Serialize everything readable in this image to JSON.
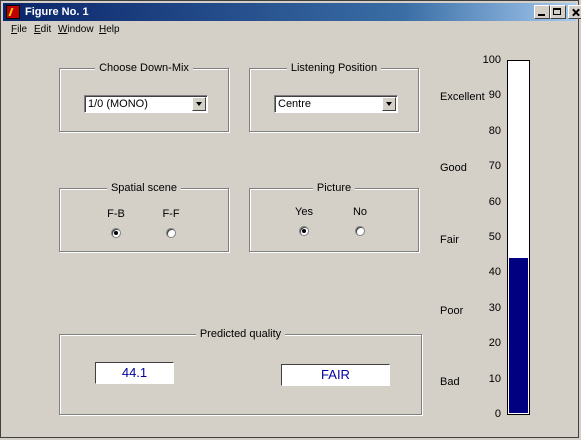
{
  "window": {
    "title": "Figure No. 1"
  },
  "menu": [
    {
      "label": "File",
      "u": "F",
      "rest": "ile"
    },
    {
      "label": "Edit",
      "u": "E",
      "rest": "dit"
    },
    {
      "label": "Window",
      "u": "W",
      "rest": "indow"
    },
    {
      "label": "Help",
      "u": "H",
      "rest": "elp"
    }
  ],
  "downmix": {
    "title": "Choose Down-Mix",
    "selected": "1/0 (MONO)"
  },
  "listening": {
    "title": "Listening Position",
    "selected": "Centre"
  },
  "spatial": {
    "title": "Spatial scene",
    "options": [
      {
        "label": "F-B",
        "selected": true
      },
      {
        "label": "F-F",
        "selected": false
      }
    ]
  },
  "picture": {
    "title": "Picture",
    "options": [
      {
        "label": "Yes",
        "selected": true
      },
      {
        "label": "No",
        "selected": false
      }
    ]
  },
  "predicted": {
    "title": "Predicted quality",
    "score": "44.1",
    "grade": "FAIR"
  },
  "scale": {
    "grades": [
      "Excellent",
      "Good",
      "Fair",
      "Poor",
      "Bad"
    ],
    "ticks": [
      "100",
      "90",
      "80",
      "70",
      "60",
      "50",
      "40",
      "30",
      "20",
      "10",
      "0"
    ],
    "value": 44.1,
    "min": 0,
    "max": 100,
    "fill_color": "#000080"
  }
}
